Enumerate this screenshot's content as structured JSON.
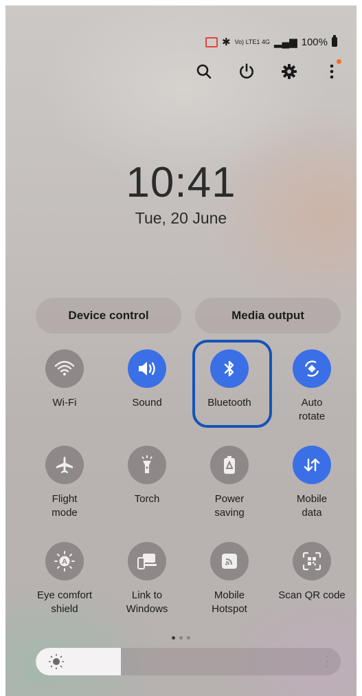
{
  "status_bar": {
    "network": "Vo) LTE1 4G",
    "battery": "100%"
  },
  "header_icons": [
    "search-icon",
    "power-icon",
    "settings-gear-icon",
    "more-vertical-icon"
  ],
  "lock": {
    "time": "10:41",
    "date": "Tue, 20 June"
  },
  "pills": {
    "device_control": "Device control",
    "media_output": "Media output"
  },
  "tiles": [
    {
      "label": "Wi-Fi",
      "icon": "wifi-icon",
      "on": false
    },
    {
      "label": "Sound",
      "icon": "sound-icon",
      "on": true
    },
    {
      "label": "Bluetooth",
      "icon": "bluetooth-icon",
      "on": true
    },
    {
      "label": "Auto\nrotate",
      "icon": "auto-rotate-icon",
      "on": true
    },
    {
      "label": "Flight\nmode",
      "icon": "airplane-icon",
      "on": false
    },
    {
      "label": "Torch",
      "icon": "torch-icon",
      "on": false
    },
    {
      "label": "Power\nsaving",
      "icon": "battery-saver-icon",
      "on": false
    },
    {
      "label": "Mobile\ndata",
      "icon": "mobile-data-icon",
      "on": true
    },
    {
      "label": "Eye comfort\nshield",
      "icon": "eye-comfort-icon",
      "on": false
    },
    {
      "label": "Link to\nWindows",
      "icon": "link-windows-icon",
      "on": false
    },
    {
      "label": "Mobile\nHotspot",
      "icon": "hotspot-icon",
      "on": false
    },
    {
      "label": "Scan QR code",
      "icon": "qr-scan-icon",
      "on": false
    }
  ],
  "brightness": {
    "level": 0.28
  },
  "pager": {
    "pages": 3,
    "active": 0
  },
  "colors": {
    "accent": "#3b6fe6",
    "highlight": "#1553b8",
    "notification_dot": "#ff6a2a"
  }
}
